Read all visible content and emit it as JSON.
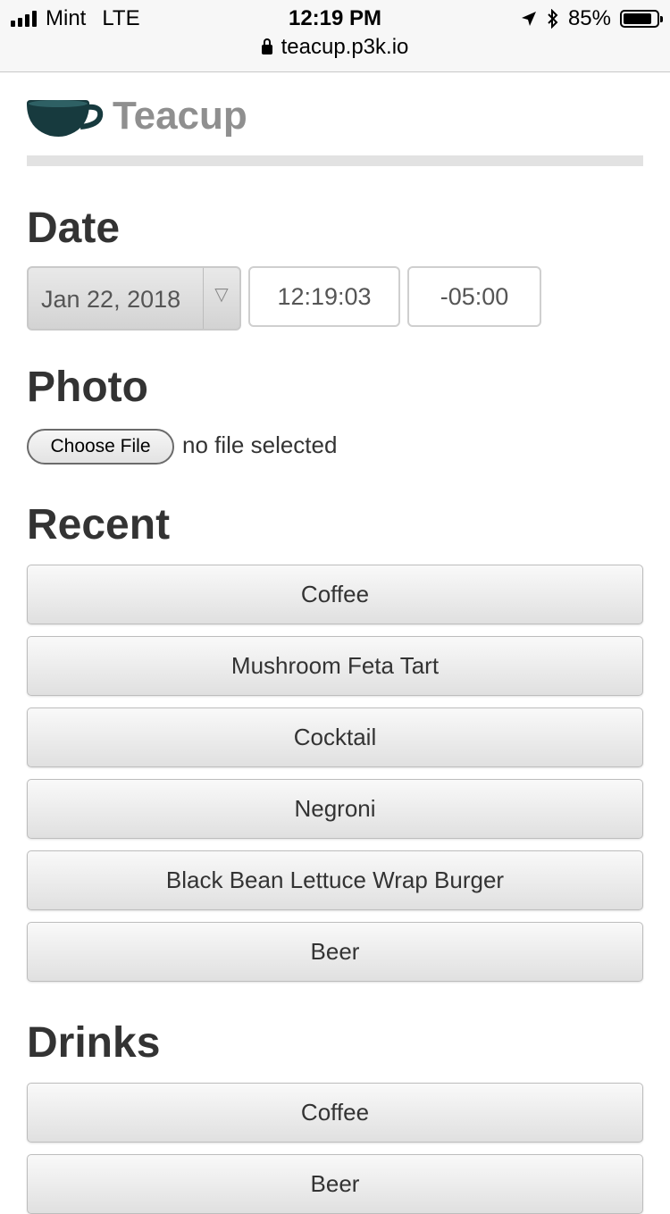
{
  "status_bar": {
    "carrier": "Mint",
    "network": "LTE",
    "time": "12:19 PM",
    "battery": "85%",
    "battery_level": 0.85,
    "url": "teacup.p3k.io"
  },
  "app": {
    "title": "Teacup"
  },
  "sections": {
    "date": "Date",
    "photo": "Photo",
    "recent": "Recent",
    "drinks": "Drinks"
  },
  "date": {
    "date_value": "Jan 22, 2018",
    "time_value": "12:19:03",
    "tz_value": "-05:00"
  },
  "photo": {
    "button": "Choose File",
    "status": "no file selected"
  },
  "recent": [
    "Coffee",
    "Mushroom Feta Tart",
    "Cocktail",
    "Negroni",
    "Black Bean Lettuce Wrap Burger",
    "Beer"
  ],
  "drinks": [
    "Coffee",
    "Beer"
  ],
  "colors": {
    "cup": "#173a3e",
    "title": "#8f8f8f"
  }
}
